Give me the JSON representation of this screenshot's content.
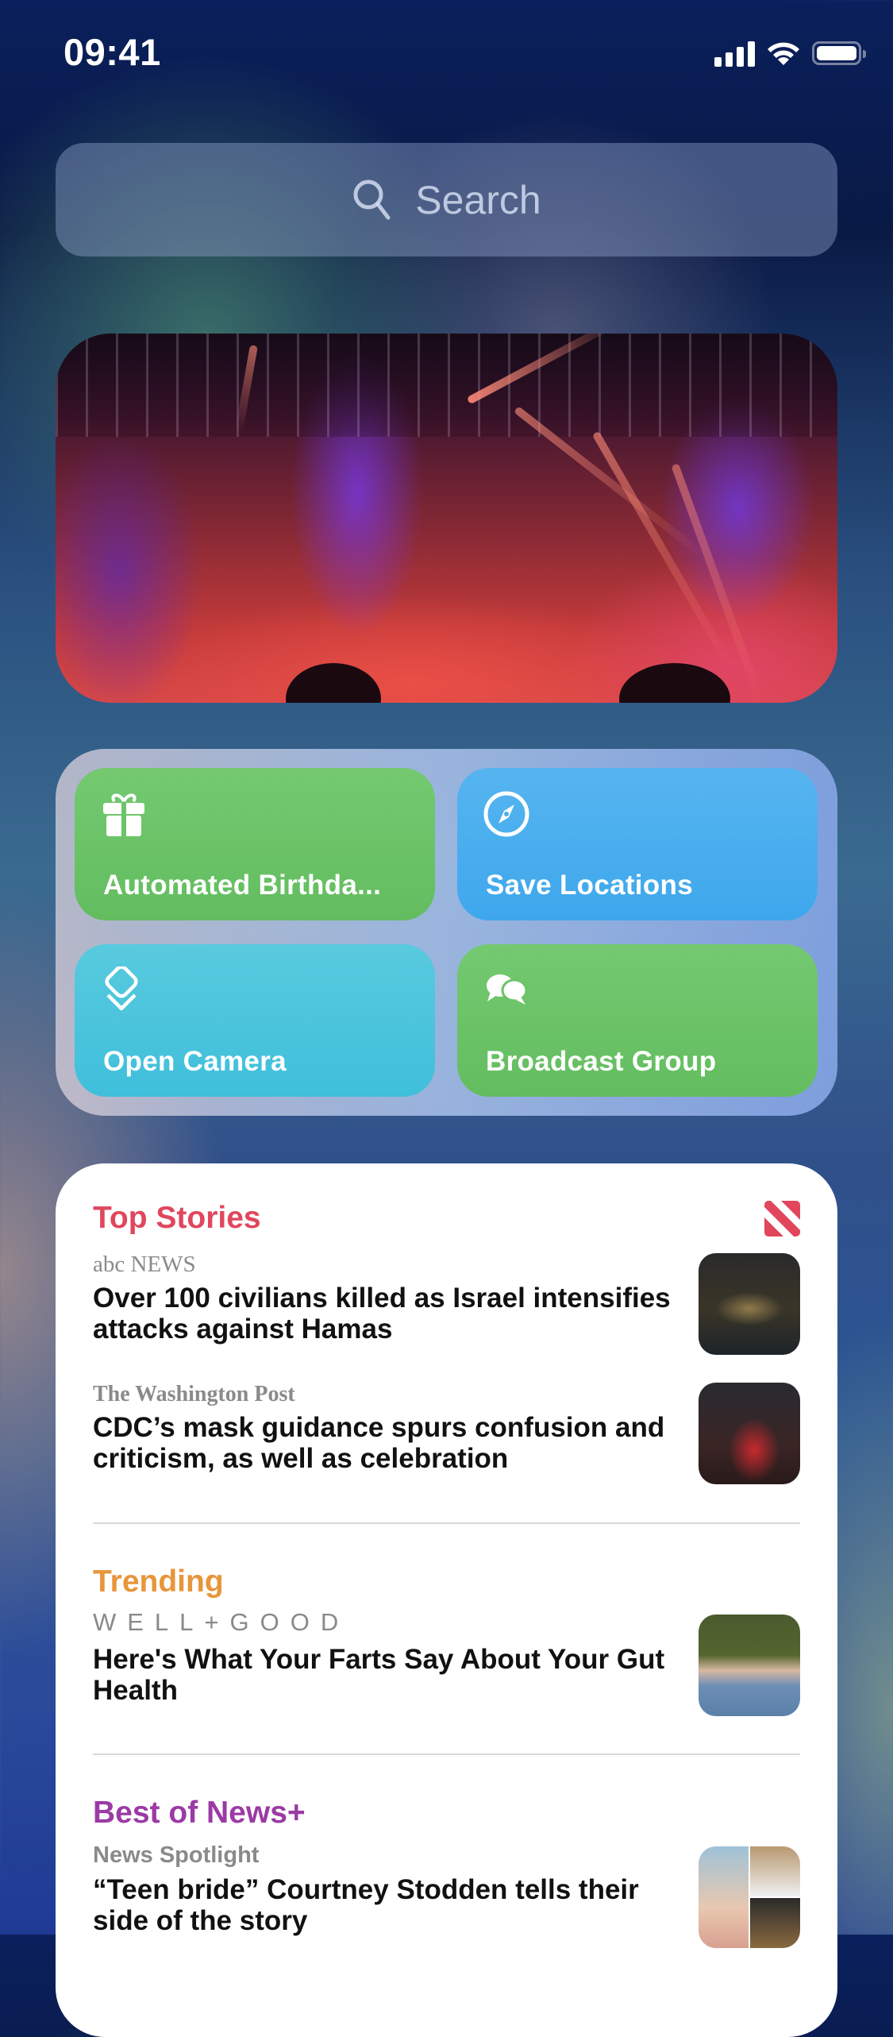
{
  "status_bar": {
    "time": "09:41",
    "icons": [
      "cellular-signal-icon",
      "wifi-icon",
      "battery-icon"
    ]
  },
  "search": {
    "placeholder": "Search",
    "icon": "search-icon"
  },
  "photo_widget": {
    "description": "Concert stage photo with purple and red lights"
  },
  "shortcuts_widget": {
    "items": [
      {
        "label": "Automated Birthda...",
        "icon": "gift-icon",
        "color": "#6bc468"
      },
      {
        "label": "Save Locations",
        "icon": "compass-icon",
        "color": "#4aaeee"
      },
      {
        "label": "Open Camera",
        "icon": "shortcuts-layers-icon",
        "color": "#4cc5dd"
      },
      {
        "label": "Broadcast Group",
        "icon": "chat-bubbles-icon",
        "color": "#6bc468"
      }
    ]
  },
  "news_widget": {
    "app_icon": "apple-news-icon",
    "sections": [
      {
        "title": "Top Stories",
        "color": "#e0475d",
        "stories": [
          {
            "source": "abc NEWS",
            "headline": "Over 100 civilians killed as Israel intensifies attacks against Hamas"
          },
          {
            "source": "The Washington Post",
            "headline": "CDC’s mask guidance spurs confusion and criticism, as well as celebration"
          }
        ]
      },
      {
        "title": "Trending",
        "color": "#e8953a",
        "stories": [
          {
            "source": "WELL+GOOD",
            "headline": "Here's What Your Farts Say About Your Gut Health"
          }
        ]
      },
      {
        "title": "Best of News+",
        "color": "#9b3aa5",
        "stories": [
          {
            "source": "News Spotlight",
            "headline": "“Teen bride” Courtney Stodden tells their side of the story"
          }
        ]
      }
    ]
  }
}
